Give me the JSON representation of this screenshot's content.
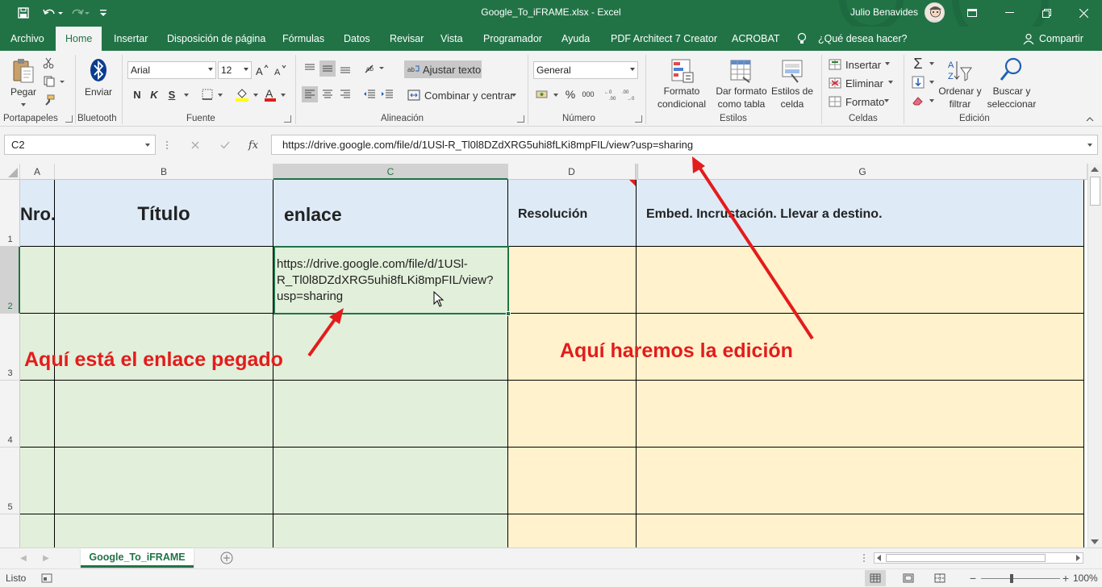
{
  "window": {
    "title": "Google_To_iFRAME.xlsx  -  Excel",
    "user": "Julio Benavides",
    "colors": {
      "brand": "#217346",
      "annotation": "#e31c1c"
    }
  },
  "qat": {
    "save_icon": "save-icon",
    "undo_icon": "undo-icon",
    "redo_icon": "redo-icon",
    "customize_icon": "customize-icon"
  },
  "tabs": [
    "Archivo",
    "Home",
    "Insertar",
    "Disposición de página",
    "Fórmulas",
    "Datos",
    "Revisar",
    "Vista",
    "Programador",
    "Ayuda",
    "PDF Architect 7 Creator",
    "ACROBAT"
  ],
  "tell_me": "¿Qué desea hacer?",
  "share": "Compartir",
  "ribbon": {
    "clipboard": {
      "label": "Portapapeles",
      "paste": "Pegar"
    },
    "bluetooth": {
      "label": "Bluetooth",
      "send": "Enviar"
    },
    "font": {
      "label": "Fuente",
      "name": "Arial",
      "size": "12",
      "bold": "N",
      "italic": "K",
      "underline": "S"
    },
    "alignment": {
      "label": "Alineación",
      "wrap": "Ajustar texto",
      "merge": "Combinar y centrar"
    },
    "number": {
      "label": "Número",
      "format": "General",
      "percent": "%",
      "thousands": "000"
    },
    "styles": {
      "label": "Estilos",
      "conditional": [
        "Formato",
        "condicional"
      ],
      "table": [
        "Dar formato",
        "como tabla"
      ],
      "cell_styles": [
        "Estilos de",
        "celda"
      ]
    },
    "cells": {
      "label": "Celdas",
      "insert": "Insertar",
      "delete": "Eliminar",
      "format": "Formato"
    },
    "editing": {
      "label": "Edición",
      "sort": [
        "Ordenar y",
        "filtrar"
      ],
      "find": [
        "Buscar y",
        "seleccionar"
      ]
    }
  },
  "formula_bar": {
    "name_box": "C2",
    "fx": "fx",
    "formula": "https://drive.google.com/file/d/1USl-R_Tl0l8DZdXRG5uhi8fLKi8mpFIL/view?usp=sharing"
  },
  "sheet": {
    "columns": [
      "A",
      "B",
      "C",
      "D",
      "G"
    ],
    "rows": [
      "1",
      "2",
      "3",
      "4",
      "5"
    ],
    "headers": {
      "a": "Nro.",
      "b": "Título",
      "c": "enlace",
      "d": "Resolución",
      "g": "Embed. Incrustación. Llevar a destino."
    },
    "c2_lines": [
      "https://drive.google.com/file/d/1USl-",
      "R_Tl0l8DZdXRG5uhi8fLKi8mpFIL/view?",
      "usp=sharing"
    ],
    "selected_cell": "C2"
  },
  "annotations": {
    "left": "Aquí está el enlace pegado",
    "right": "Aquí haremos la edición"
  },
  "sheet_tabs": [
    "Google_To_iFRAME"
  ],
  "status": {
    "mode": "Listo",
    "zoom": "100%"
  }
}
